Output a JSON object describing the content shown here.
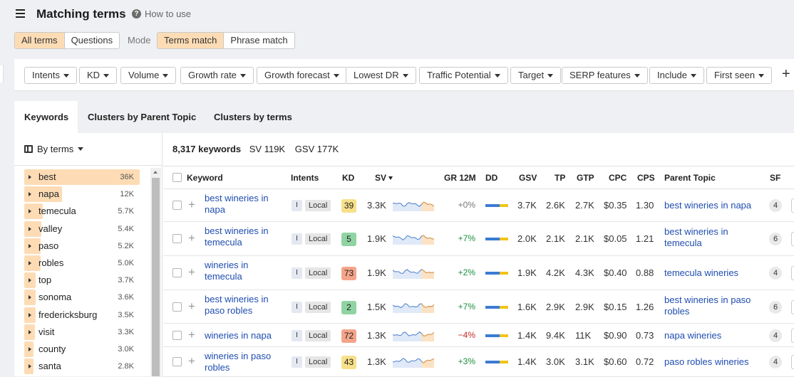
{
  "header": {
    "title": "Matching terms",
    "how_to": "How to use"
  },
  "scope": {
    "all_terms": "All terms",
    "questions": "Questions"
  },
  "mode": {
    "label": "Mode",
    "terms_match": "Terms match",
    "phrase_match": "Phrase match"
  },
  "filters": [
    "Intents",
    "KD",
    "Volume",
    "Growth rate",
    "Growth forecast",
    "Lowest DR",
    "Traffic Potential",
    "Target",
    "SERP features",
    "Include",
    "First seen"
  ],
  "tabs": [
    "Keywords",
    "Clusters by Parent Topic",
    "Clusters by terms"
  ],
  "sidebar": {
    "group_label": "By terms",
    "terms": [
      {
        "name": "best",
        "count": "36K",
        "share": 1.0
      },
      {
        "name": "napa",
        "count": "12K",
        "share": 0.33
      },
      {
        "name": "temecula",
        "count": "5.7K",
        "share": 0.16
      },
      {
        "name": "valley",
        "count": "5.4K",
        "share": 0.15
      },
      {
        "name": "paso",
        "count": "5.2K",
        "share": 0.14
      },
      {
        "name": "robles",
        "count": "5.0K",
        "share": 0.14
      },
      {
        "name": "top",
        "count": "3.7K",
        "share": 0.1
      },
      {
        "name": "sonoma",
        "count": "3.6K",
        "share": 0.1
      },
      {
        "name": "fredericksburg",
        "count": "3.5K",
        "share": 0.1
      },
      {
        "name": "visit",
        "count": "3.3K",
        "share": 0.09
      },
      {
        "name": "county",
        "count": "3.0K",
        "share": 0.08
      },
      {
        "name": "santa",
        "count": "2.8K",
        "share": 0.08
      }
    ]
  },
  "summary": {
    "keywords": "8,317 keywords",
    "sv": "SV 119K",
    "gsv": "GSV 177K"
  },
  "columns": {
    "keyword": "Keyword",
    "intents": "Intents",
    "kd": "KD",
    "sv": "SV",
    "gr": "GR 12M",
    "dd": "DD",
    "gsv": "GSV",
    "tp": "TP",
    "gtp": "GTP",
    "cpc": "CPC",
    "cps": "CPS",
    "parent": "Parent Topic",
    "sf": "SF"
  },
  "rows": [
    {
      "keyword": "best wineries in napa",
      "intent": "I",
      "local": "Local",
      "kd": "39",
      "kd_color": "#f6e08a",
      "sv": "3.3K",
      "gr": "+0%",
      "gr_color": "#777777",
      "gsv": "3.7K",
      "tp": "2.6K",
      "gtp": "2.7K",
      "cpc": "$0.35",
      "cps": "1.30",
      "parent": "best wineries in napa",
      "sf": "4"
    },
    {
      "keyword": "best wineries in temecula",
      "intent": "I",
      "local": "Local",
      "kd": "5",
      "kd_color": "#8fd4a2",
      "sv": "1.9K",
      "gr": "+7%",
      "gr_color": "#1a8f3c",
      "gsv": "2.0K",
      "tp": "2.1K",
      "gtp": "2.1K",
      "cpc": "$0.05",
      "cps": "1.21",
      "parent": "best wineries in temecula",
      "sf": "6"
    },
    {
      "keyword": "wineries in temecula",
      "intent": "I",
      "local": "Local",
      "kd": "73",
      "kd_color": "#f4a48a",
      "sv": "1.9K",
      "gr": "+2%",
      "gr_color": "#1a8f3c",
      "gsv": "1.9K",
      "tp": "4.2K",
      "gtp": "4.3K",
      "cpc": "$0.40",
      "cps": "0.88",
      "parent": "temecula wineries",
      "sf": "4"
    },
    {
      "keyword": "best wineries in paso robles",
      "intent": "I",
      "local": "Local",
      "kd": "2",
      "kd_color": "#8fd4a2",
      "sv": "1.5K",
      "gr": "+7%",
      "gr_color": "#1a8f3c",
      "gsv": "1.6K",
      "tp": "2.9K",
      "gtp": "2.9K",
      "cpc": "$0.15",
      "cps": "1.26",
      "parent": "best wineries in paso robles",
      "sf": "6"
    },
    {
      "keyword": "wineries in napa",
      "intent": "I",
      "local": "Local",
      "kd": "72",
      "kd_color": "#f4a48a",
      "sv": "1.3K",
      "gr": "−4%",
      "gr_color": "#c62828",
      "gsv": "1.4K",
      "tp": "9.4K",
      "gtp": "11K",
      "cpc": "$0.90",
      "cps": "0.73",
      "parent": "napa wineries",
      "sf": "4"
    },
    {
      "keyword": "wineries in paso robles",
      "intent": "I",
      "local": "Local",
      "kd": "43",
      "kd_color": "#f6e08a",
      "sv": "1.3K",
      "gr": "+3%",
      "gr_color": "#1a8f3c",
      "gsv": "1.4K",
      "tp": "3.0K",
      "gtp": "3.1K",
      "cpc": "$0.60",
      "cps": "0.72",
      "parent": "paso robles wineries",
      "sf": "4"
    }
  ]
}
